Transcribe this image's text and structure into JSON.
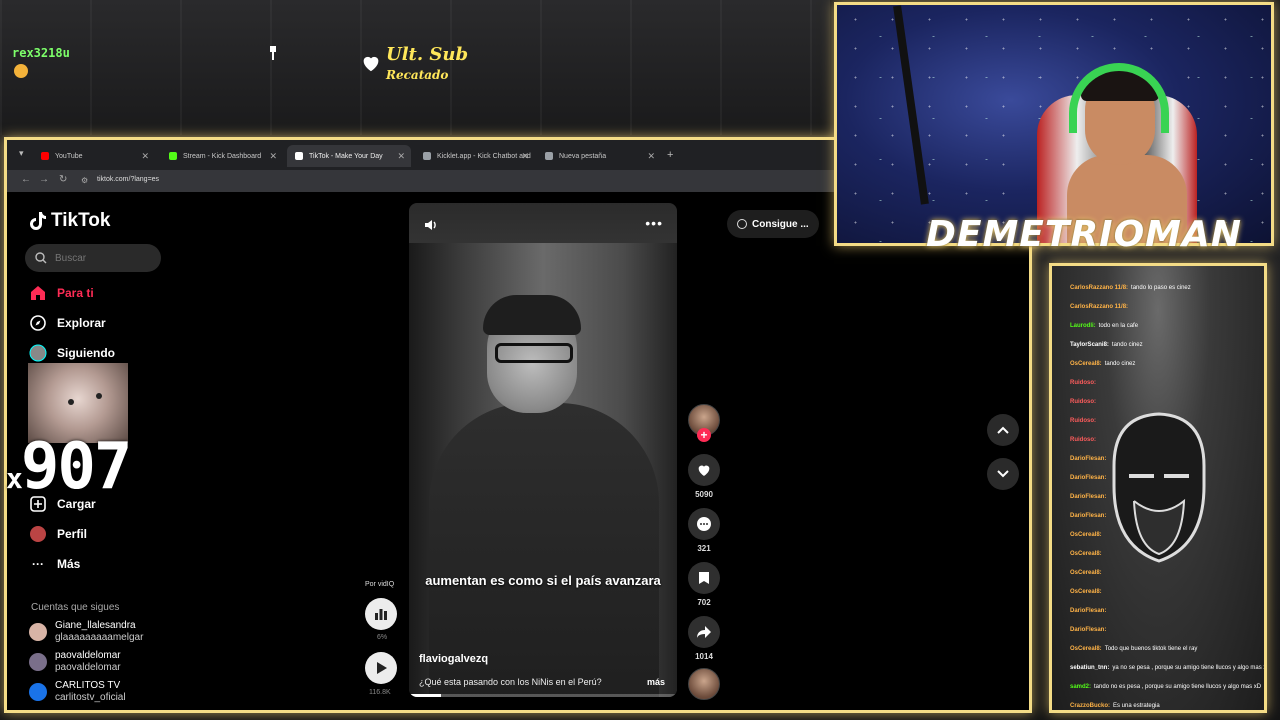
{
  "overlay": {
    "chat_user": "rex3218u",
    "sub_title": "Ult. Sub",
    "sub_name": "Recatado",
    "combo_prefix": "x",
    "combo_count": "907",
    "streamer_name": "DEMETRIOMAN"
  },
  "browser": {
    "tabs": [
      {
        "label": "YouTube",
        "favicon_color": "#ff0000",
        "active": false
      },
      {
        "label": "Stream - Kick Dashboard",
        "favicon_color": "#53fc18",
        "active": false
      },
      {
        "label": "TikTok - Make Your Day",
        "favicon_color": "#ffffff",
        "active": true
      },
      {
        "label": "Kicklet.app - Kick Chatbot and",
        "favicon_color": "#9aa0a6",
        "active": false
      },
      {
        "label": "Nueva pestaña",
        "favicon_color": "#9aa0a6",
        "active": false
      }
    ],
    "url": "tiktok.com/?lang=es"
  },
  "tiktok": {
    "logo": "TikTok",
    "search_placeholder": "Buscar",
    "nav": {
      "for_you": "Para ti",
      "explore": "Explorar",
      "following": "Siguiendo",
      "upload": "Cargar",
      "profile": "Perfil",
      "more": "Más"
    },
    "following_section": "Cuentas que sigues",
    "accounts": [
      {
        "name": "Giane_llalesandra",
        "user": "glaaaaaaaaamelgar"
      },
      {
        "name": "paovaldelomar",
        "user": "paovaldelomar"
      },
      {
        "name": "CARLITOS TV",
        "user": "carlitostv_oficial"
      }
    ],
    "get_app": "Consigue ...",
    "video": {
      "caption": "aumentan es como si el país avanzara",
      "author": "flaviogalvezq",
      "description": "¿Qué esta pasando con los NiNis en el Perú?",
      "more": "más",
      "progress": 0.12
    },
    "actions": {
      "likes": "5090",
      "comments": "321",
      "saves": "702",
      "shares": "1014"
    },
    "vidiq": {
      "label": "Por vidIQ",
      "percent": "6%",
      "views": "116.8K"
    }
  },
  "chat": [
    {
      "user": "CarlosRazzano 11/8:",
      "msg": "tando lo paso es cinez",
      "color": "#ffb347"
    },
    {
      "user": "CarlosRazzano 11/8:",
      "msg": "",
      "color": "#ffb347"
    },
    {
      "user": "Laurodli:",
      "msg": "todo en la cafe",
      "color": "#53fc18"
    },
    {
      "user": "TaylorScani8:",
      "msg": "tando cinez",
      "color": "#ffffff"
    },
    {
      "user": "OsCereal8:",
      "msg": "tando cinez",
      "color": "#ffb347"
    },
    {
      "user": "Ruidoso:",
      "msg": "",
      "color": "#ff5c5c"
    },
    {
      "user": "Ruidoso:",
      "msg": "",
      "color": "#ff5c5c"
    },
    {
      "user": "Ruidoso:",
      "msg": "",
      "color": "#ff5c5c"
    },
    {
      "user": "Ruidoso:",
      "msg": "",
      "color": "#ff5c5c"
    },
    {
      "user": "DarioFlesan:",
      "msg": "",
      "color": "#ffb347"
    },
    {
      "user": "DarioFlesan:",
      "msg": "",
      "color": "#ffb347"
    },
    {
      "user": "DarioFlesan:",
      "msg": "",
      "color": "#ffb347"
    },
    {
      "user": "DarioFlesan:",
      "msg": "",
      "color": "#ffb347"
    },
    {
      "user": "OsCereal8:",
      "msg": "",
      "color": "#ffb347"
    },
    {
      "user": "OsCereal8:",
      "msg": "",
      "color": "#ffb347"
    },
    {
      "user": "OsCereal8:",
      "msg": "",
      "color": "#ffb347"
    },
    {
      "user": "OsCereal8:",
      "msg": "",
      "color": "#ffb347"
    },
    {
      "user": "DarioFlesan:",
      "msg": "",
      "color": "#ffb347"
    },
    {
      "user": "DarioFlesan:",
      "msg": "",
      "color": "#ffb347"
    },
    {
      "user": "OsCereal8:",
      "msg": "Todo que buenos tiktok tiene el ray",
      "color": "#ffb347"
    },
    {
      "user": "sebatiun_tnn:",
      "msg": "ya no se pesa , porque su amigo tiene llucos y algo mas xD",
      "color": "#ffffff"
    },
    {
      "user": "samd2:",
      "msg": "tando no es pesa , porque su amigo tiene llucos y algo mas xD",
      "color": "#53fc18"
    },
    {
      "user": "CrazzoBucko:",
      "msg": "Es una estrategia",
      "color": "#ffb347"
    }
  ]
}
